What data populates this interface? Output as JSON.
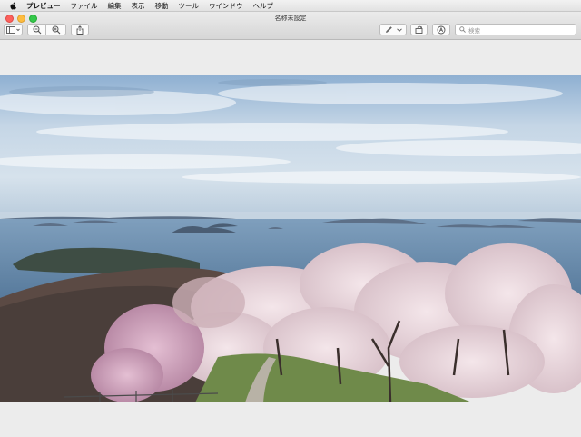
{
  "menubar": {
    "apple_icon": "apple-logo-icon",
    "items": [
      "プレビュー",
      "ファイル",
      "編集",
      "表示",
      "移動",
      "ツール",
      "ウインドウ",
      "ヘルプ"
    ]
  },
  "window": {
    "title": "名称未設定"
  },
  "toolbar": {
    "sidebar_icon": "sidebar-toggle-icon",
    "zoom_out_icon": "zoom-out-icon",
    "zoom_in_icon": "zoom-in-icon",
    "share_icon": "share-icon",
    "markup_icon": "pen-markup-icon",
    "rotate_icon": "rotate-icon",
    "annotate_icon": "annotate-circle-icon",
    "search_placeholder": "検索"
  },
  "document": {
    "image_description_icon": "cherry-blossom-landscape-photo"
  },
  "colors": {
    "accent_red": "#fc605c",
    "accent_yellow": "#fdbc40",
    "accent_green": "#34c84a"
  }
}
